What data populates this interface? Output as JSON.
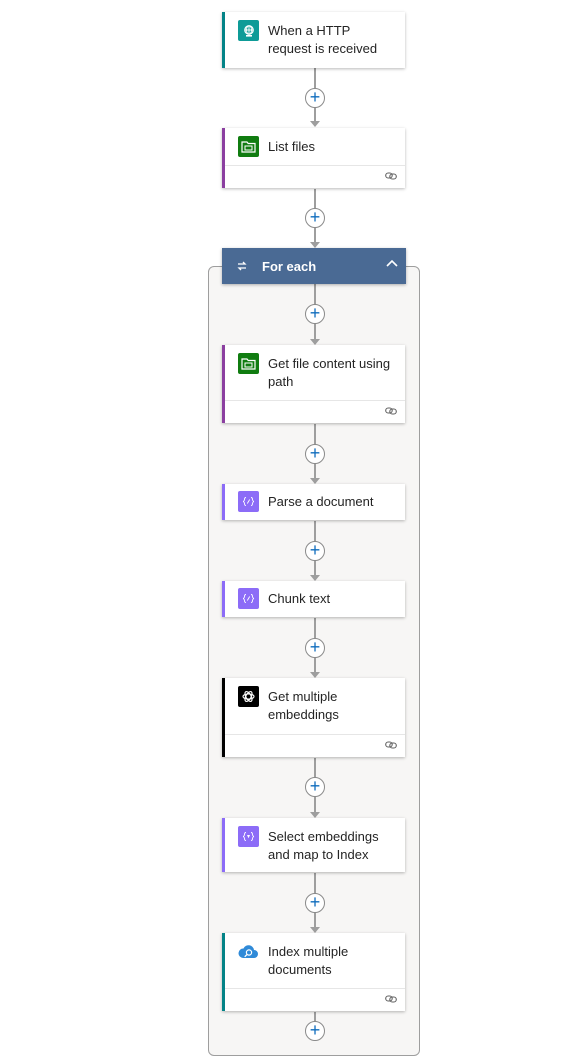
{
  "flow": {
    "trigger": {
      "title": "When a HTTP request is received",
      "icon": "http-request-icon",
      "accent": "#038387",
      "icon_bg": "#0e9b97"
    },
    "list_files": {
      "title": "List files",
      "icon": "file-system-icon",
      "accent": "#8b3fa0",
      "icon_bg": "#107c10"
    },
    "for_each": {
      "title": "For each",
      "icon": "loop-icon",
      "header_bg": "#4a6a94"
    },
    "get_file_content": {
      "title": "Get file content using path",
      "icon": "file-system-icon",
      "accent": "#8b3fa0",
      "icon_bg": "#107c10"
    },
    "parse_document": {
      "title": "Parse a document",
      "icon": "data-operation-icon",
      "accent": "#8c6cf7",
      "icon_bg": "#8c6cf7"
    },
    "chunk_text": {
      "title": "Chunk text",
      "icon": "data-operation-icon",
      "accent": "#8c6cf7",
      "icon_bg": "#8c6cf7"
    },
    "get_embeddings": {
      "title": "Get multiple embeddings",
      "icon": "openai-icon",
      "accent": "#000000",
      "icon_bg": "#000000"
    },
    "select_embeddings": {
      "title": "Select embeddings and map to Index",
      "icon": "select-operation-icon",
      "accent": "#8c6cf7",
      "icon_bg": "#8c6cf7"
    },
    "index_documents": {
      "title": "Index multiple documents",
      "icon": "ai-search-icon",
      "accent": "#038387",
      "icon_bg": "#2f8ad8"
    }
  },
  "add_button_symbol": "+"
}
